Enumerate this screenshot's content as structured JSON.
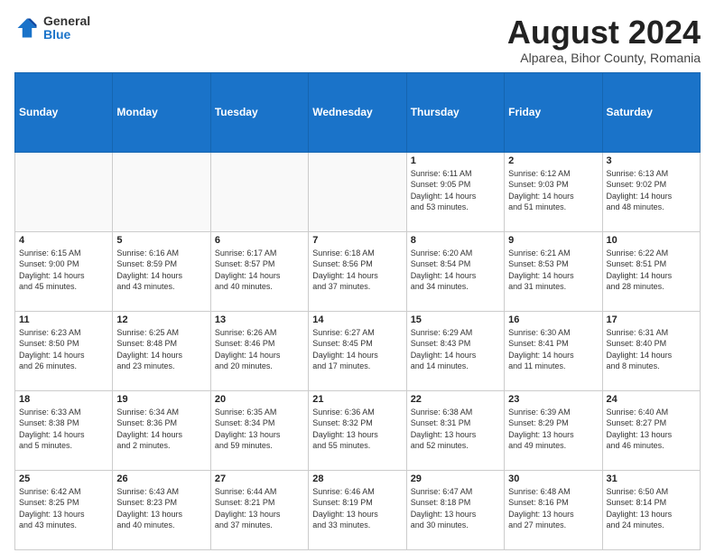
{
  "logo": {
    "general": "General",
    "blue": "Blue"
  },
  "header": {
    "month": "August 2024",
    "location": "Alparea, Bihor County, Romania"
  },
  "days": [
    "Sunday",
    "Monday",
    "Tuesday",
    "Wednesday",
    "Thursday",
    "Friday",
    "Saturday"
  ],
  "weeks": [
    [
      {
        "day": "",
        "content": ""
      },
      {
        "day": "",
        "content": ""
      },
      {
        "day": "",
        "content": ""
      },
      {
        "day": "",
        "content": ""
      },
      {
        "day": "1",
        "content": "Sunrise: 6:11 AM\nSunset: 9:05 PM\nDaylight: 14 hours\nand 53 minutes."
      },
      {
        "day": "2",
        "content": "Sunrise: 6:12 AM\nSunset: 9:03 PM\nDaylight: 14 hours\nand 51 minutes."
      },
      {
        "day": "3",
        "content": "Sunrise: 6:13 AM\nSunset: 9:02 PM\nDaylight: 14 hours\nand 48 minutes."
      }
    ],
    [
      {
        "day": "4",
        "content": "Sunrise: 6:15 AM\nSunset: 9:00 PM\nDaylight: 14 hours\nand 45 minutes."
      },
      {
        "day": "5",
        "content": "Sunrise: 6:16 AM\nSunset: 8:59 PM\nDaylight: 14 hours\nand 43 minutes."
      },
      {
        "day": "6",
        "content": "Sunrise: 6:17 AM\nSunset: 8:57 PM\nDaylight: 14 hours\nand 40 minutes."
      },
      {
        "day": "7",
        "content": "Sunrise: 6:18 AM\nSunset: 8:56 PM\nDaylight: 14 hours\nand 37 minutes."
      },
      {
        "day": "8",
        "content": "Sunrise: 6:20 AM\nSunset: 8:54 PM\nDaylight: 14 hours\nand 34 minutes."
      },
      {
        "day": "9",
        "content": "Sunrise: 6:21 AM\nSunset: 8:53 PM\nDaylight: 14 hours\nand 31 minutes."
      },
      {
        "day": "10",
        "content": "Sunrise: 6:22 AM\nSunset: 8:51 PM\nDaylight: 14 hours\nand 28 minutes."
      }
    ],
    [
      {
        "day": "11",
        "content": "Sunrise: 6:23 AM\nSunset: 8:50 PM\nDaylight: 14 hours\nand 26 minutes."
      },
      {
        "day": "12",
        "content": "Sunrise: 6:25 AM\nSunset: 8:48 PM\nDaylight: 14 hours\nand 23 minutes."
      },
      {
        "day": "13",
        "content": "Sunrise: 6:26 AM\nSunset: 8:46 PM\nDaylight: 14 hours\nand 20 minutes."
      },
      {
        "day": "14",
        "content": "Sunrise: 6:27 AM\nSunset: 8:45 PM\nDaylight: 14 hours\nand 17 minutes."
      },
      {
        "day": "15",
        "content": "Sunrise: 6:29 AM\nSunset: 8:43 PM\nDaylight: 14 hours\nand 14 minutes."
      },
      {
        "day": "16",
        "content": "Sunrise: 6:30 AM\nSunset: 8:41 PM\nDaylight: 14 hours\nand 11 minutes."
      },
      {
        "day": "17",
        "content": "Sunrise: 6:31 AM\nSunset: 8:40 PM\nDaylight: 14 hours\nand 8 minutes."
      }
    ],
    [
      {
        "day": "18",
        "content": "Sunrise: 6:33 AM\nSunset: 8:38 PM\nDaylight: 14 hours\nand 5 minutes."
      },
      {
        "day": "19",
        "content": "Sunrise: 6:34 AM\nSunset: 8:36 PM\nDaylight: 14 hours\nand 2 minutes."
      },
      {
        "day": "20",
        "content": "Sunrise: 6:35 AM\nSunset: 8:34 PM\nDaylight: 13 hours\nand 59 minutes."
      },
      {
        "day": "21",
        "content": "Sunrise: 6:36 AM\nSunset: 8:32 PM\nDaylight: 13 hours\nand 55 minutes."
      },
      {
        "day": "22",
        "content": "Sunrise: 6:38 AM\nSunset: 8:31 PM\nDaylight: 13 hours\nand 52 minutes."
      },
      {
        "day": "23",
        "content": "Sunrise: 6:39 AM\nSunset: 8:29 PM\nDaylight: 13 hours\nand 49 minutes."
      },
      {
        "day": "24",
        "content": "Sunrise: 6:40 AM\nSunset: 8:27 PM\nDaylight: 13 hours\nand 46 minutes."
      }
    ],
    [
      {
        "day": "25",
        "content": "Sunrise: 6:42 AM\nSunset: 8:25 PM\nDaylight: 13 hours\nand 43 minutes."
      },
      {
        "day": "26",
        "content": "Sunrise: 6:43 AM\nSunset: 8:23 PM\nDaylight: 13 hours\nand 40 minutes."
      },
      {
        "day": "27",
        "content": "Sunrise: 6:44 AM\nSunset: 8:21 PM\nDaylight: 13 hours\nand 37 minutes."
      },
      {
        "day": "28",
        "content": "Sunrise: 6:46 AM\nSunset: 8:19 PM\nDaylight: 13 hours\nand 33 minutes."
      },
      {
        "day": "29",
        "content": "Sunrise: 6:47 AM\nSunset: 8:18 PM\nDaylight: 13 hours\nand 30 minutes."
      },
      {
        "day": "30",
        "content": "Sunrise: 6:48 AM\nSunset: 8:16 PM\nDaylight: 13 hours\nand 27 minutes."
      },
      {
        "day": "31",
        "content": "Sunrise: 6:50 AM\nSunset: 8:14 PM\nDaylight: 13 hours\nand 24 minutes."
      }
    ]
  ]
}
